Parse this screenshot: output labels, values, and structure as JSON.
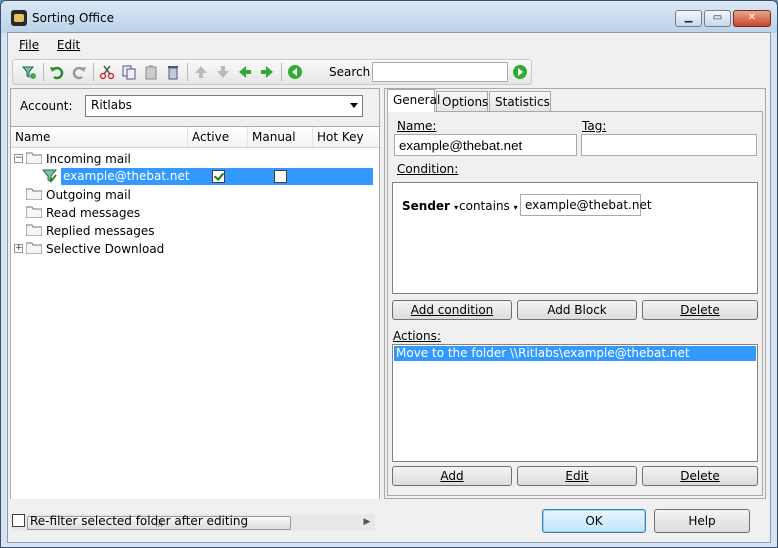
{
  "window": {
    "title": "Sorting Office"
  },
  "menu": {
    "file": "File",
    "edit": "Edit"
  },
  "toolbar": {
    "search_label": "Search",
    "search_value": ""
  },
  "account": {
    "label": "Account:",
    "value": "Ritlabs"
  },
  "tree": {
    "columns": [
      "Name",
      "Active",
      "Manual",
      "Hot Key"
    ],
    "items": [
      {
        "label": "Incoming mail"
      },
      {
        "label": "example@thebat.net",
        "active": true,
        "manual": false
      },
      {
        "label": "Outgoing mail"
      },
      {
        "label": "Read messages"
      },
      {
        "label": "Replied messages"
      },
      {
        "label": "Selective Download"
      }
    ]
  },
  "tabs": [
    "General",
    "Options",
    "Statistics"
  ],
  "general": {
    "name_label": "Name:",
    "name_value": "example@thebat.net",
    "tag_label": "Tag:",
    "tag_value": "",
    "condition_label": "Condition:",
    "condition": {
      "field": "Sender",
      "operator": "contains",
      "value": "example@thebat.net"
    },
    "add_condition": "Add condition",
    "add_block": "Add Block",
    "delete": "Delete",
    "actions_label": "Actions:",
    "action_item": "Move to the folder \\\\Ritlabs\\example@thebat.net",
    "add": "Add",
    "edit": "Edit",
    "delete2": "Delete"
  },
  "footer": {
    "refilter_label": "Re-filter selected folder after editing",
    "ok": "OK",
    "help": "Help"
  },
  "colors": {
    "selection": "#3399ff",
    "title_gradient": "#bcd2ea"
  }
}
